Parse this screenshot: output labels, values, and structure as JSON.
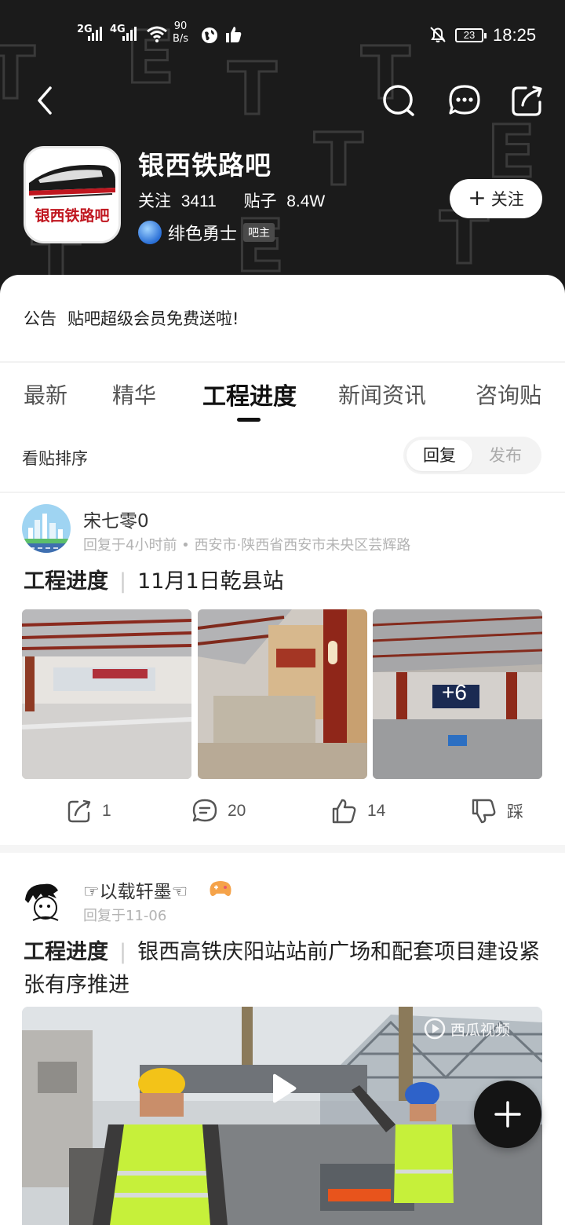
{
  "status_bar": {
    "net1": "2G",
    "net2": "4G",
    "speed_value": "90",
    "speed_unit": "B/s",
    "battery": "23",
    "time": "18:25"
  },
  "forum": {
    "name": "银西铁路吧",
    "avatar_text": "银西铁路吧",
    "follow_label": "关注",
    "followers_label": "关注",
    "followers_value": "3411",
    "posts_label": "贴子",
    "posts_value": "8.4W",
    "owner_name": "绯色勇士",
    "owner_badge": "吧主",
    "follow_button": "关注"
  },
  "notice": {
    "label": "公告",
    "text": "贴吧超级会员免费送啦!"
  },
  "tabs": [
    "最新",
    "精华",
    "工程进度",
    "新闻资讯",
    "咨询贴"
  ],
  "active_tab": "工程进度",
  "sort": {
    "label": "看贴排序",
    "options": [
      "回复",
      "发布"
    ],
    "selected": "回复"
  },
  "posts": [
    {
      "author": "宋七零0",
      "meta": "回复于4小时前 • 西安市·陕西省西安市未央区芸辉路",
      "tag": "工程进度",
      "title": "11月1日乾县站",
      "more_images": "+6",
      "share_count": "1",
      "comment_count": "20",
      "like_count": "14",
      "dislike_label": "踩"
    },
    {
      "author": "☞以载轩墨☜",
      "meta": "回复于11-06",
      "tag": "工程进度",
      "title": "银西高铁庆阳站站前广场和配套项目建设紧张有序推进",
      "video_watermark": "西瓜视频"
    }
  ]
}
